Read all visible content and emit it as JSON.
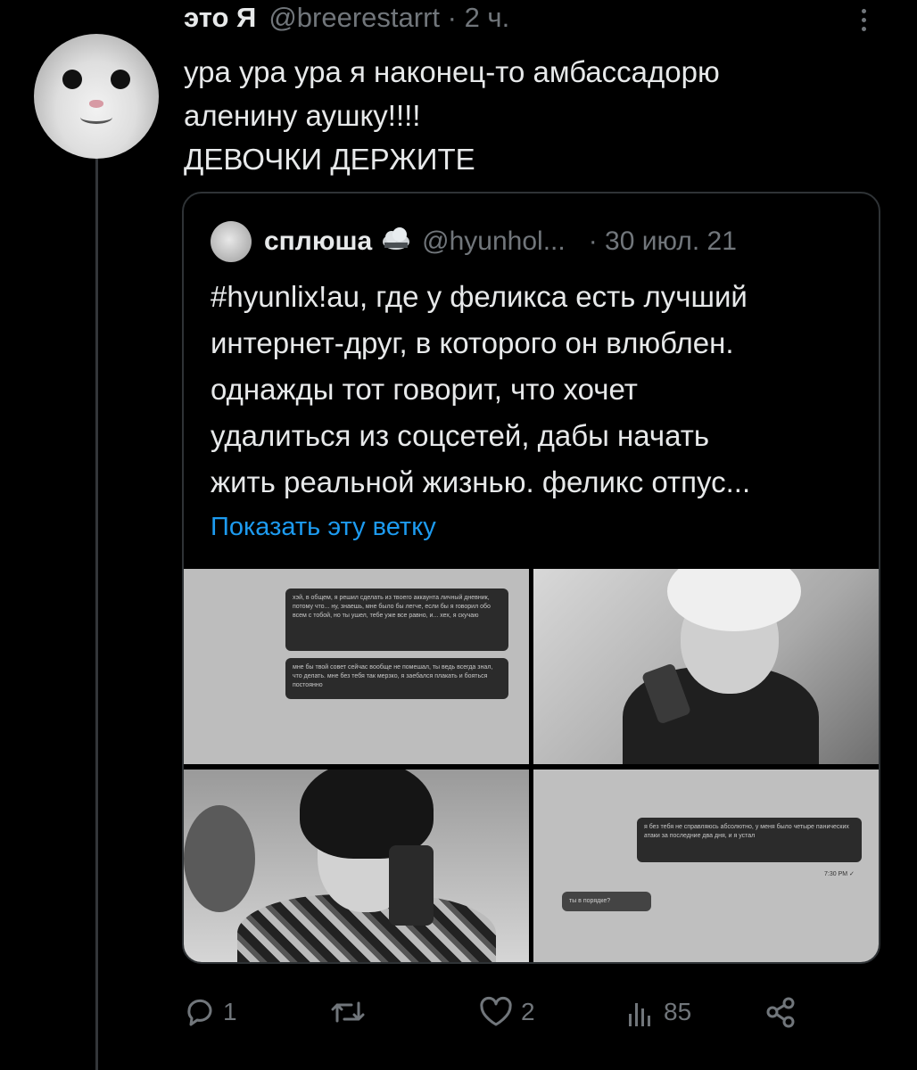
{
  "tweet": {
    "name": "это Я",
    "handle": "@breerestarrt · 2 ч.",
    "text_lines": [
      "ура ура ура я наконец-то амбассадорю",
      "аленину аушку!!!!",
      "ДЕВОЧКИ ДЕРЖИТЕ"
    ]
  },
  "quote": {
    "name": "сплюша",
    "handle": "@hyunhol...",
    "date": "30 июл. 21",
    "text_lines": [
      "#hyunlix!au, где у феликса есть лучший",
      "интернет-друг, в которого он влюблен.",
      "однажды тот говорит, что хочет",
      "удалиться из соцсетей, дабы начать",
      "жить реальной жизнью. феликс отпус..."
    ],
    "show_thread": "Показать эту ветку",
    "media": {
      "bubble1": "хэй, в общем, я решил сделать из твоего аккаунта личный дневник, потому что... ну, знаешь, мне было бы легче, если бы я говорил обо всем с тобой, но ты ушел, тебе уже все равно, и... хех, я скучаю",
      "bubble2": "мне бы твой совет сейчас вообще не помешал, ты ведь всегда знал, что делать. мне без тебя так мерзко, я заебался плакать и бояться постоянно",
      "bubble3": "я без тебя не справляюсь абсолютно, у меня было четыре панических атаки за последние два дня, и я устал",
      "timestamp": "7:30 PM ✓",
      "bubble4": "ты в порядке?"
    }
  },
  "actions": {
    "reply_count": "1",
    "retweet_count": "",
    "like_count": "2",
    "views_count": "85"
  }
}
